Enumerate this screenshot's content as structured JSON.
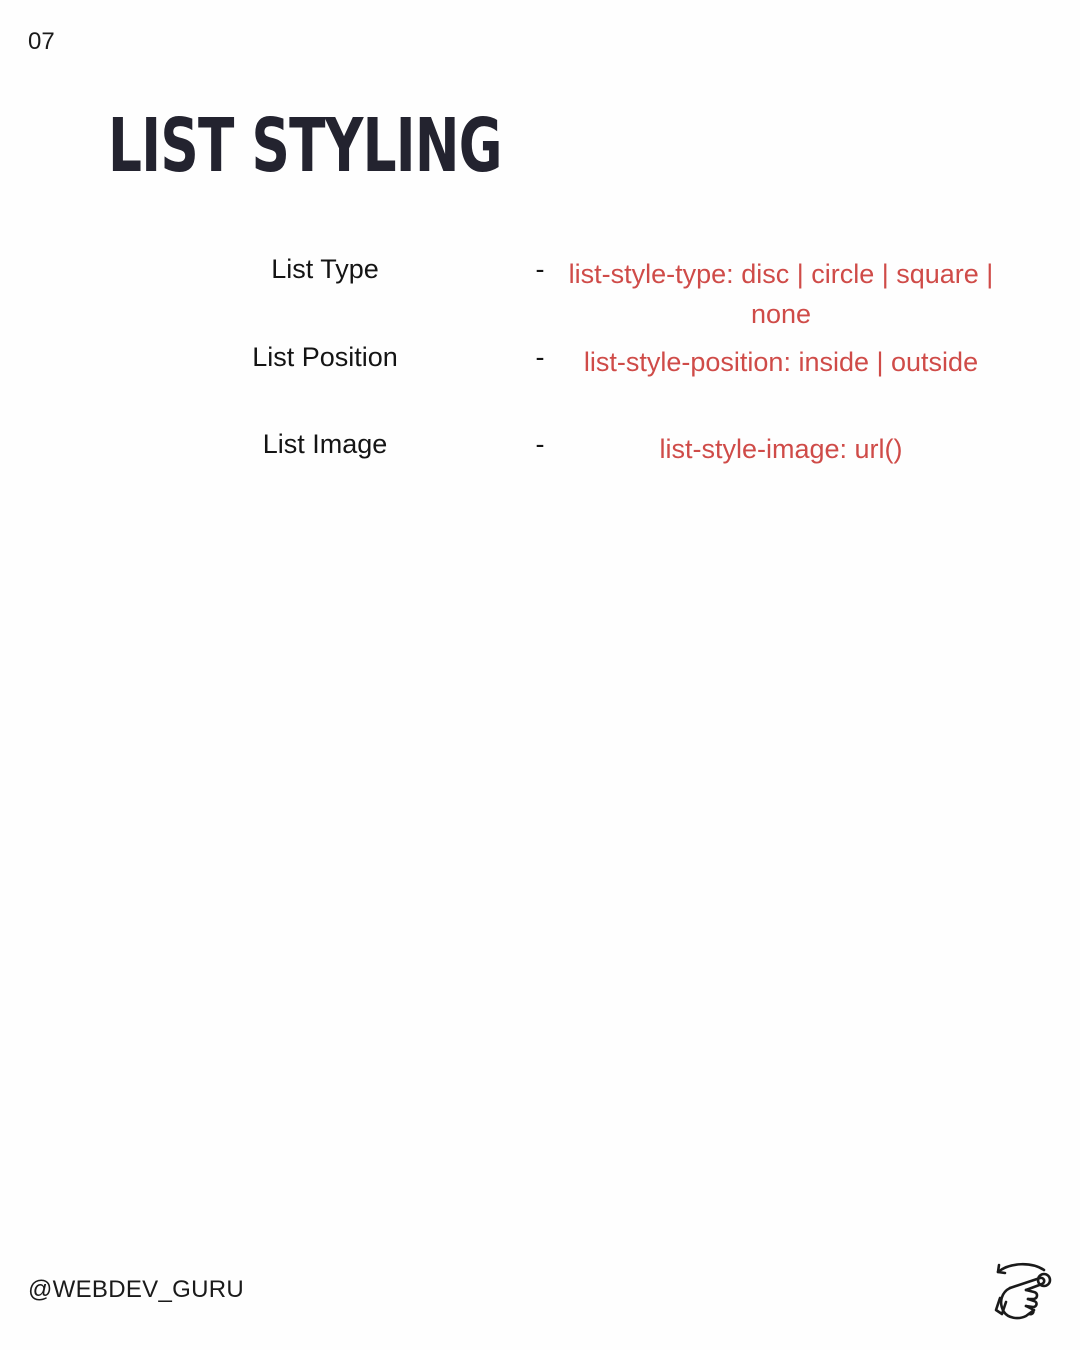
{
  "page_number": "07",
  "title": "LIST STYLING",
  "rows": [
    {
      "label": "List Type",
      "dash": "-",
      "value": "list-style-type: disc | circle | square | none"
    },
    {
      "label": "List Position",
      "dash": "-",
      "value": "list-style-position: inside | outside"
    },
    {
      "label": "List Image",
      "dash": "-",
      "value": "list-style-image: url()"
    }
  ],
  "footer": {
    "handle": "@WEBDEV_GURU",
    "swipe_icon": "swipe-hand-icon"
  },
  "colors": {
    "title": "#23232f",
    "value": "#cf4b48",
    "text": "#141414",
    "background": "#fefefe"
  }
}
